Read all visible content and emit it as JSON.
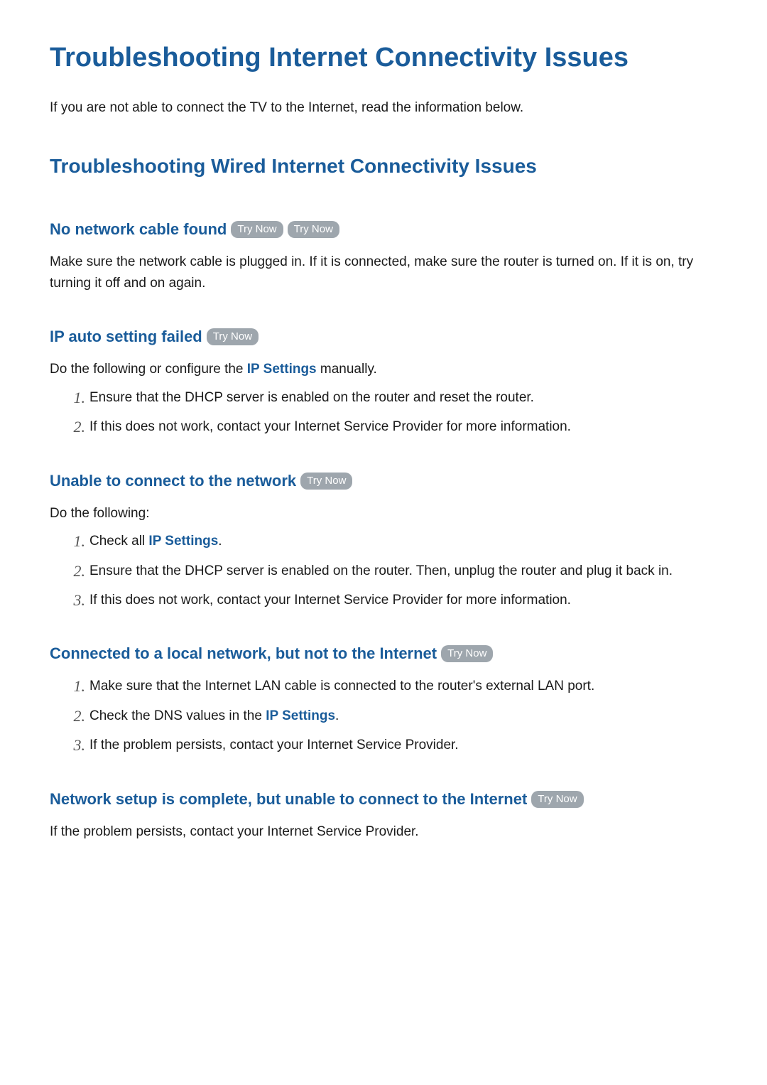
{
  "page_title": "Troubleshooting Internet Connectivity Issues",
  "intro": "If you are not able to connect the TV to the Internet, read the information below.",
  "subtitle": "Troubleshooting Wired Internet Connectivity Issues",
  "try_now_label": "Try Now",
  "link_text": {
    "ip_settings": "IP Settings"
  },
  "sections": [
    {
      "heading": "No network cable found",
      "trynow_count": 2,
      "body": "Make sure the network cable is plugged in. If it is connected, make sure the router is turned on. If it is on, try turning it off and on again.",
      "steps": []
    },
    {
      "heading": "IP auto setting failed",
      "trynow_count": 1,
      "lead_before": "Do the following or configure the ",
      "lead_link": "IP Settings",
      "lead_after": " manually.",
      "steps": [
        {
          "n": "1.",
          "text": "Ensure that the DHCP server is enabled on the router and reset the router."
        },
        {
          "n": "2.",
          "text": "If this does not work, contact your Internet Service Provider for more information."
        }
      ]
    },
    {
      "heading": "Unable to connect to the network",
      "trynow_count": 1,
      "body": "Do the following:",
      "steps": [
        {
          "n": "1.",
          "before": "Check all ",
          "link": "IP Settings",
          "after": "."
        },
        {
          "n": "2.",
          "text": "Ensure that the DHCP server is enabled on the router. Then, unplug the router and plug it back in."
        },
        {
          "n": "3.",
          "text": "If this does not work, contact your Internet Service Provider for more information."
        }
      ]
    },
    {
      "heading": "Connected to a local network, but not to the Internet",
      "trynow_count": 1,
      "steps": [
        {
          "n": "1.",
          "text": "Make sure that the Internet LAN cable is connected to the router's external LAN port."
        },
        {
          "n": "2.",
          "before": "Check the DNS values in the ",
          "link": "IP Settings",
          "after": "."
        },
        {
          "n": "3.",
          "text": "If the problem persists, contact your Internet Service Provider."
        }
      ]
    },
    {
      "heading": "Network setup is complete, but unable to connect to the Internet",
      "trynow_count": 1,
      "body": "If the problem persists, contact your Internet Service Provider.",
      "steps": []
    }
  ]
}
